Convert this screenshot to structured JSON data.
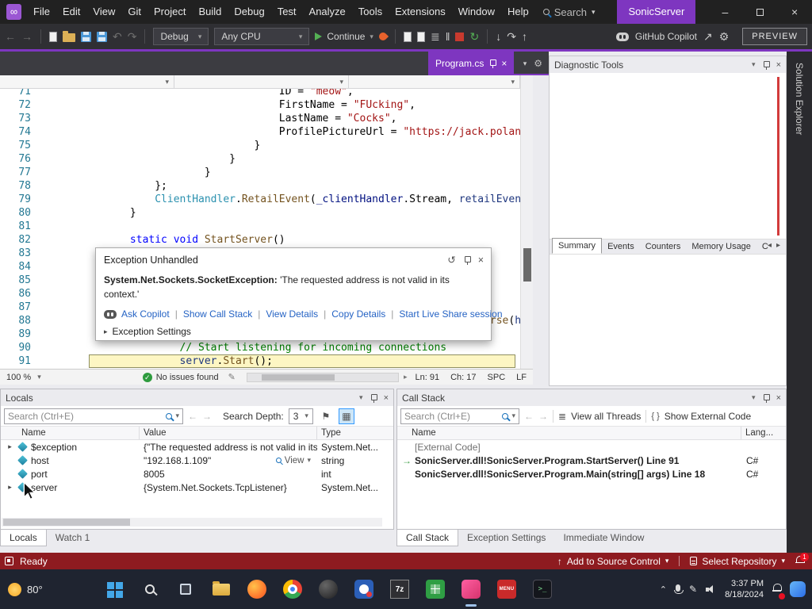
{
  "titlebar": {
    "menus": [
      "File",
      "Edit",
      "View",
      "Git",
      "Project",
      "Build",
      "Debug",
      "Test",
      "Analyze",
      "Tools",
      "Extensions",
      "Window",
      "Help"
    ],
    "search_label": "Search",
    "solution_name": "SonicServer"
  },
  "toolbar": {
    "config_value": "Debug",
    "platform_value": "Any CPU",
    "continue_label": "Continue",
    "copil_label": "GitHub Copilot",
    "preview_label": "PREVIEW"
  },
  "editor": {
    "tab_title": "Program.cs",
    "status": {
      "zoom": "100 %",
      "health": "No issues found",
      "line": "Ln: 91",
      "column": "Ch: 17",
      "spaces": "SPC",
      "eol": "LF"
    },
    "lines": [
      {
        "n": 71,
        "ind": 36,
        "tokens": [
          {
            "c": "p",
            "t": "ID = "
          },
          {
            "c": "s",
            "t": "\"meow\""
          },
          {
            "c": "p",
            "t": ","
          }
        ]
      },
      {
        "n": 72,
        "ind": 36,
        "tokens": [
          {
            "c": "p",
            "t": "FirstName = "
          },
          {
            "c": "s",
            "t": "\"FUcking\""
          },
          {
            "c": "p",
            "t": ","
          }
        ]
      },
      {
        "n": 73,
        "ind": 36,
        "tokens": [
          {
            "c": "p",
            "t": "LastName = "
          },
          {
            "c": "s",
            "t": "\"Cocks\""
          },
          {
            "c": "p",
            "t": ","
          }
        ]
      },
      {
        "n": 74,
        "ind": 36,
        "tokens": [
          {
            "c": "p",
            "t": "ProfilePictureUrl = "
          },
          {
            "c": "s",
            "t": "\"https://jack.polan"
          }
        ]
      },
      {
        "n": 75,
        "ind": 32,
        "tokens": [
          {
            "c": "p",
            "t": "}"
          }
        ]
      },
      {
        "n": 76,
        "ind": 28,
        "tokens": [
          {
            "c": "p",
            "t": "}"
          }
        ]
      },
      {
        "n": 77,
        "ind": 24,
        "tokens": [
          {
            "c": "p",
            "t": "}"
          }
        ]
      },
      {
        "n": 78,
        "ind": 16,
        "tokens": [
          {
            "c": "p",
            "t": "};"
          }
        ]
      },
      {
        "n": 79,
        "ind": 16,
        "tokens": [
          {
            "c": "t",
            "t": "ClientHandler"
          },
          {
            "c": "p",
            "t": "."
          },
          {
            "c": "m",
            "t": "RetailEvent"
          },
          {
            "c": "p",
            "t": "("
          },
          {
            "c": "f",
            "t": "_clientHandler"
          },
          {
            "c": "p",
            "t": ".Stream, "
          },
          {
            "c": "l",
            "t": "retailEven"
          }
        ]
      },
      {
        "n": 80,
        "ind": 12,
        "tokens": [
          {
            "c": "p",
            "t": "}"
          }
        ]
      },
      {
        "n": 81,
        "ind": 0,
        "tokens": []
      },
      {
        "n": 82,
        "ind": 12,
        "tokens": [
          {
            "c": "k",
            "t": "static"
          },
          {
            "c": "p",
            "t": " "
          },
          {
            "c": "k",
            "t": "void"
          },
          {
            "c": "p",
            "t": " "
          },
          {
            "c": "m",
            "t": "StartServer"
          },
          {
            "c": "p",
            "t": "()"
          }
        ]
      },
      {
        "n": 83,
        "ind": 0,
        "tokens": []
      },
      {
        "n": 84,
        "ind": 0,
        "tokens": []
      },
      {
        "n": 85,
        "ind": 0,
        "tokens": []
      },
      {
        "n": 86,
        "ind": 0,
        "tokens": []
      },
      {
        "n": 87,
        "ind": 0,
        "tokens": []
      },
      {
        "n": 88,
        "ind": 70,
        "tokens": [
          {
            "c": "m",
            "t": "rse"
          },
          {
            "c": "p",
            "t": "("
          },
          {
            "c": "l",
            "t": "ho"
          }
        ]
      },
      {
        "n": 89,
        "ind": 0,
        "tokens": []
      },
      {
        "n": 90,
        "ind": 20,
        "tokens": [
          {
            "c": "c",
            "t": "// Start listening for incoming connections"
          }
        ]
      },
      {
        "n": 91,
        "ind": 20,
        "highlight": true,
        "tokens": [
          {
            "c": "l",
            "t": "server"
          },
          {
            "c": "p",
            "t": "."
          },
          {
            "c": "m",
            "t": "Start"
          },
          {
            "c": "p",
            "t": "();"
          }
        ]
      }
    ]
  },
  "exception": {
    "title": "Exception Unhandled",
    "type": "System.Net.Sockets.SocketException:",
    "message": " 'The requested address is not valid in its context.'",
    "links": [
      "Ask Copilot",
      "Show Call Stack",
      "View Details",
      "Copy Details",
      "Start Live Share session"
    ],
    "settings_label": "Exception Settings"
  },
  "diagnostics": {
    "title": "Diagnostic Tools",
    "tabs": [
      {
        "label": "Summary",
        "selected": true
      },
      {
        "label": "Events"
      },
      {
        "label": "Counters"
      },
      {
        "label": "Memory Usage"
      },
      {
        "label": "C"
      }
    ]
  },
  "solution_explorer_label": "Solution Explorer",
  "locals": {
    "title": "Locals",
    "search_placeholder": "Search (Ctrl+E)",
    "depth_label": "Search Depth:",
    "depth_value": "3",
    "columns": [
      "Name",
      "Value",
      "Type"
    ],
    "rows": [
      {
        "expandable": true,
        "name": "$exception",
        "value": "{\"The requested address is not valid in its...",
        "type": "System.Net..."
      },
      {
        "expandable": false,
        "name": "host",
        "value": "\"192.168.1.109\"",
        "view_label": "View",
        "type": "string"
      },
      {
        "expandable": false,
        "name": "port",
        "value": "8005",
        "type": "int"
      },
      {
        "expandable": true,
        "name": "server",
        "value": "{System.Net.Sockets.TcpListener}",
        "type": "System.Net..."
      }
    ],
    "tabs": [
      {
        "label": "Locals",
        "selected": true
      },
      {
        "label": "Watch 1"
      }
    ]
  },
  "callstack": {
    "title": "Call Stack",
    "search_placeholder": "Search (Ctrl+E)",
    "view_threads_label": "View all Threads",
    "external_code_label": "Show External Code",
    "columns": [
      "Name",
      "Lang..."
    ],
    "frames": [
      {
        "name": "[External Code]",
        "lang": "",
        "external": true,
        "current": false
      },
      {
        "name": "SonicServer.dll!SonicServer.Program.StartServer() Line 91",
        "lang": "C#",
        "external": false,
        "current": true
      },
      {
        "name": "SonicServer.dll!SonicServer.Program.Main(string[] args) Line 18",
        "lang": "C#",
        "external": false,
        "current": false
      }
    ],
    "tabs": [
      {
        "label": "Call Stack",
        "selected": true
      },
      {
        "label": "Exception Settings"
      },
      {
        "label": "Immediate Window"
      }
    ]
  },
  "statusbar": {
    "ready_label": "Ready",
    "source_control_label": "Add to Source Control",
    "repository_label": "Select Repository",
    "notification_count": "1"
  },
  "taskbar": {
    "weather": "80°",
    "icons": [
      {
        "name": "start-button",
        "kind": "start"
      },
      {
        "name": "search-button",
        "kind": "search"
      },
      {
        "name": "task-view-button",
        "kind": "taskview"
      },
      {
        "name": "file-explorer-icon",
        "kind": "explorer"
      },
      {
        "name": "firefox-icon",
        "kind": "firefox"
      },
      {
        "name": "chrome-icon",
        "kind": "chrome"
      },
      {
        "name": "dark-browser-icon",
        "kind": "darkball"
      },
      {
        "name": "media-app-icon",
        "kind": "media"
      },
      {
        "name": "7zip-icon",
        "kind": "sevenzip",
        "label": "7z"
      },
      {
        "name": "spreadsheet-app-icon",
        "kind": "sheets"
      },
      {
        "name": "capture-app-icon",
        "kind": "pink",
        "active": true
      },
      {
        "name": "menu-app-icon",
        "kind": "menu",
        "label": "MENU"
      },
      {
        "name": "terminal-icon",
        "kind": "terminal",
        "label": ">_"
      }
    ],
    "clock_time": "3:37 PM",
    "clock_date": "8/18/2024"
  }
}
